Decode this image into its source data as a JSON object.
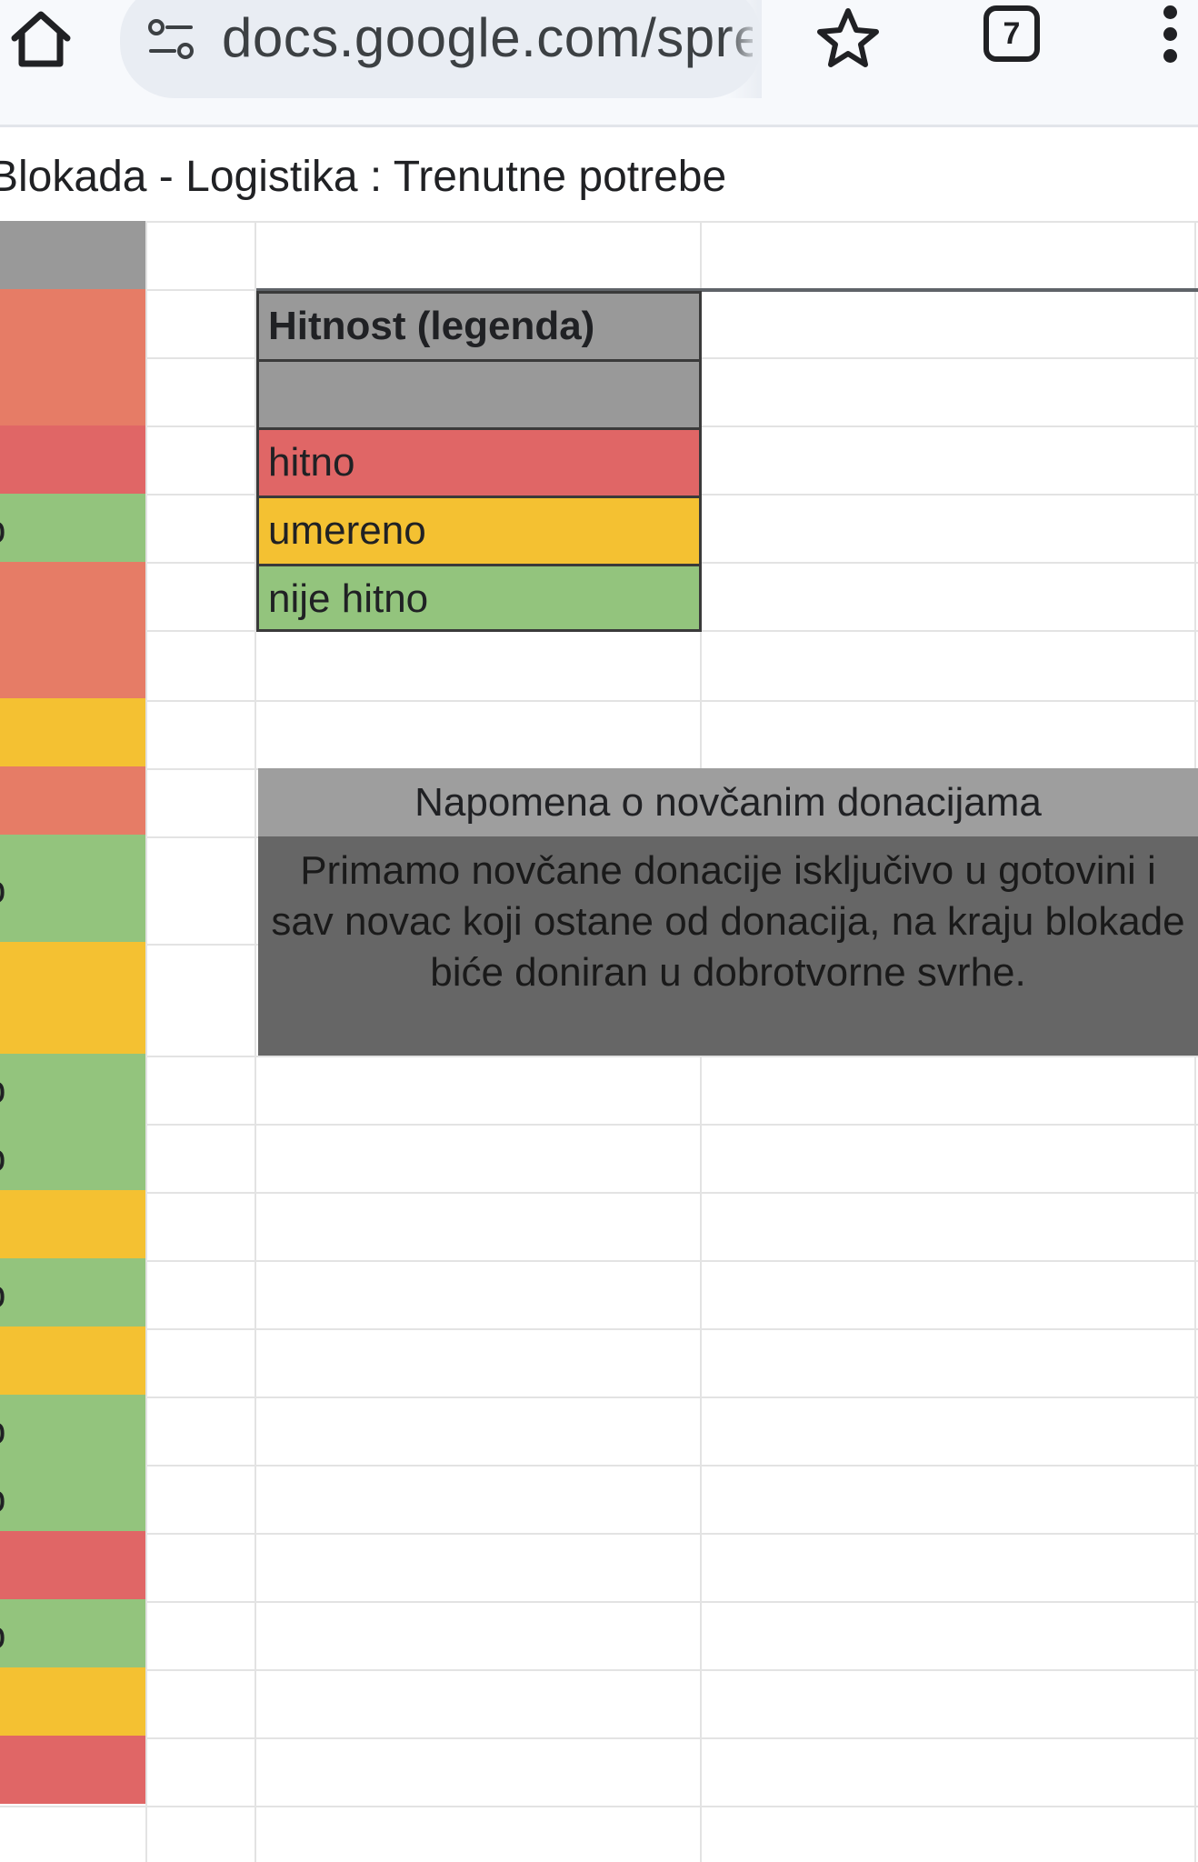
{
  "browser": {
    "url_display": "docs.google.com/spre",
    "tab_count": "7",
    "icons": [
      "home-icon",
      "site-settings-icon",
      "star-icon",
      "tabs-icon",
      "menu-icon"
    ]
  },
  "doc": {
    "title": "Blokada - Logistika : Trenutne potrebe"
  },
  "legend": {
    "header": "Hitnost (legenda)",
    "items": [
      {
        "label": "",
        "color": "#999999"
      },
      {
        "label": "hitno",
        "color": "#e06666"
      },
      {
        "label": "umereno",
        "color": "#f4c132"
      },
      {
        "label": "nije hitno",
        "color": "#93c47d"
      }
    ]
  },
  "note": {
    "title": "Napomena o novčanim donacijama",
    "body": "Primamo novčane donacije isključivo u gotovini i sav novac koji ostane od donacija, na kraju blokade biće doniran u dobrotvorne svrhe."
  },
  "column_a": {
    "colors": {
      "header": "#999999",
      "salmon": "#e67c66",
      "red": "#e06666",
      "orange": "#f4c132",
      "green": "#93c47d"
    },
    "cells": [
      {
        "color": "header",
        "peek": ""
      },
      {
        "color": "salmon",
        "peek": ""
      },
      {
        "color": "red",
        "peek": ""
      },
      {
        "color": "green",
        "peek": "o"
      },
      {
        "color": "salmon",
        "peek": ""
      },
      {
        "color": "orange",
        "peek": ""
      },
      {
        "color": "salmon",
        "peek": ""
      },
      {
        "color": "green",
        "peek": "o"
      },
      {
        "color": "orange",
        "peek": ""
      },
      {
        "color": "green",
        "peek": "o"
      },
      {
        "color": "green",
        "peek": "o"
      },
      {
        "color": "orange",
        "peek": ""
      },
      {
        "color": "green",
        "peek": "o"
      },
      {
        "color": "orange",
        "peek": ""
      },
      {
        "color": "green",
        "peek": "o"
      },
      {
        "color": "green",
        "peek": "o"
      },
      {
        "color": "red",
        "peek": ""
      },
      {
        "color": "green",
        "peek": "o"
      },
      {
        "color": "orange",
        "peek": ""
      },
      {
        "color": "red",
        "peek": ""
      }
    ]
  }
}
